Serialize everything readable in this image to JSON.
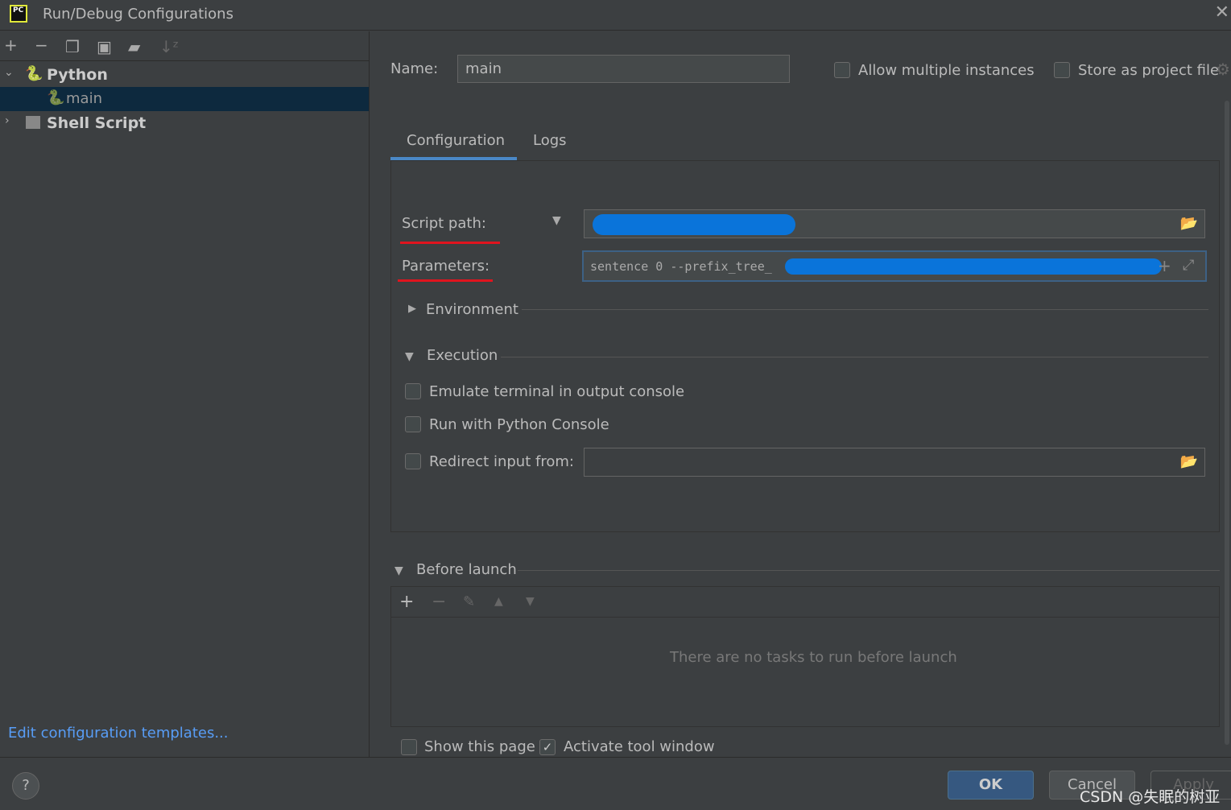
{
  "window": {
    "title": "Run/Debug Configurations",
    "logo": "PC"
  },
  "toolbar": {
    "icons": [
      "plus-icon",
      "minus-icon",
      "copy-icon",
      "save-icon",
      "folder-add-icon",
      "sort-az-icon"
    ]
  },
  "tree": [
    {
      "label": "Python",
      "expanded": true,
      "children": [
        {
          "label": "main",
          "selected": true
        }
      ]
    },
    {
      "label": "Shell Script",
      "expanded": false
    }
  ],
  "edit_templates": "Edit configuration templates...",
  "name": {
    "label": "Name:",
    "value": "main"
  },
  "allow_multiple": {
    "label": "Allow multiple instances",
    "checked": false
  },
  "store_project": {
    "label": "Store as project file",
    "checked": false
  },
  "tabs": [
    {
      "label": "Configuration",
      "active": true
    },
    {
      "label": "Logs",
      "active": false
    }
  ],
  "script_path": {
    "label": "Script path:"
  },
  "parameters": {
    "label": "Parameters:",
    "value": "sentence 0 --prefix_tree_"
  },
  "environment": "Environment",
  "execution": "Execution",
  "emulate": {
    "label": "Emulate terminal in output console",
    "checked": false
  },
  "python_console": {
    "label": "Run with Python Console",
    "checked": false
  },
  "redirect": {
    "label": "Redirect input from:",
    "checked": false,
    "value": ""
  },
  "before_launch": {
    "title": "Before launch",
    "empty": "There are no tasks to run before launch"
  },
  "show_page": {
    "label": "Show this page",
    "checked": false
  },
  "activate_tool": {
    "label": "Activate tool window",
    "checked": true
  },
  "buttons": {
    "ok": "OK",
    "cancel": "Cancel",
    "apply": "Apply",
    "help": "?"
  },
  "watermark": "CSDN @失眠的树亚",
  "colors": {
    "accent": "#4a88c7",
    "selection": "#0d293e",
    "ok": "#365880",
    "annotation": "#e0141e",
    "redaction": "#0a74da"
  }
}
